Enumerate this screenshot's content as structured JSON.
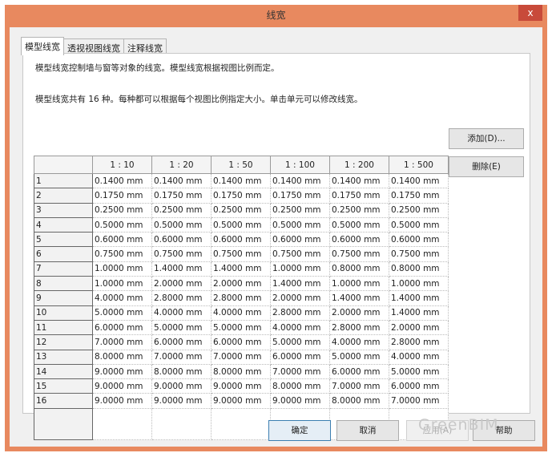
{
  "window": {
    "title": "线宽",
    "close": "x"
  },
  "tabs": [
    {
      "label": "模型线宽"
    },
    {
      "label": "透视视图线宽"
    },
    {
      "label": "注释线宽"
    }
  ],
  "description": [
    "模型线宽控制墙与窗等对象的线宽。模型线宽根据视图比例而定。",
    "模型线宽共有 16 种。每种都可以根据每个视图比例指定大小。单击单元可以修改线宽。"
  ],
  "table": {
    "columns": [
      "1 : 10",
      "1 : 20",
      "1 : 50",
      "1 : 100",
      "1 : 200",
      "1 : 500"
    ],
    "rows": [
      {
        "id": "1",
        "values": [
          "0.1400 mm",
          "0.1400 mm",
          "0.1400 mm",
          "0.1400 mm",
          "0.1400 mm",
          "0.1400 mm"
        ]
      },
      {
        "id": "2",
        "values": [
          "0.1750 mm",
          "0.1750 mm",
          "0.1750 mm",
          "0.1750 mm",
          "0.1750 mm",
          "0.1750 mm"
        ]
      },
      {
        "id": "3",
        "values": [
          "0.2500 mm",
          "0.2500 mm",
          "0.2500 mm",
          "0.2500 mm",
          "0.2500 mm",
          "0.2500 mm"
        ]
      },
      {
        "id": "4",
        "values": [
          "0.5000 mm",
          "0.5000 mm",
          "0.5000 mm",
          "0.5000 mm",
          "0.5000 mm",
          "0.5000 mm"
        ]
      },
      {
        "id": "5",
        "values": [
          "0.6000 mm",
          "0.6000 mm",
          "0.6000 mm",
          "0.6000 mm",
          "0.6000 mm",
          "0.6000 mm"
        ]
      },
      {
        "id": "6",
        "values": [
          "0.7500 mm",
          "0.7500 mm",
          "0.7500 mm",
          "0.7500 mm",
          "0.7500 mm",
          "0.7500 mm"
        ]
      },
      {
        "id": "7",
        "values": [
          "1.0000 mm",
          "1.4000 mm",
          "1.4000 mm",
          "1.0000 mm",
          "0.8000 mm",
          "0.8000 mm"
        ]
      },
      {
        "id": "8",
        "values": [
          "1.0000 mm",
          "2.0000 mm",
          "2.0000 mm",
          "1.4000 mm",
          "1.0000 mm",
          "1.0000 mm"
        ]
      },
      {
        "id": "9",
        "values": [
          "4.0000 mm",
          "2.8000 mm",
          "2.8000 mm",
          "2.0000 mm",
          "1.4000 mm",
          "1.4000 mm"
        ]
      },
      {
        "id": "10",
        "values": [
          "5.0000 mm",
          "4.0000 mm",
          "4.0000 mm",
          "2.8000 mm",
          "2.0000 mm",
          "1.4000 mm"
        ]
      },
      {
        "id": "11",
        "values": [
          "6.0000 mm",
          "5.0000 mm",
          "5.0000 mm",
          "4.0000 mm",
          "2.8000 mm",
          "2.0000 mm"
        ]
      },
      {
        "id": "12",
        "values": [
          "7.0000 mm",
          "6.0000 mm",
          "6.0000 mm",
          "5.0000 mm",
          "4.0000 mm",
          "2.8000 mm"
        ]
      },
      {
        "id": "13",
        "values": [
          "8.0000 mm",
          "7.0000 mm",
          "7.0000 mm",
          "6.0000 mm",
          "5.0000 mm",
          "4.0000 mm"
        ]
      },
      {
        "id": "14",
        "values": [
          "9.0000 mm",
          "8.0000 mm",
          "8.0000 mm",
          "7.0000 mm",
          "6.0000 mm",
          "5.0000 mm"
        ]
      },
      {
        "id": "15",
        "values": [
          "9.0000 mm",
          "9.0000 mm",
          "9.0000 mm",
          "8.0000 mm",
          "7.0000 mm",
          "6.0000 mm"
        ]
      },
      {
        "id": "16",
        "values": [
          "9.0000 mm",
          "9.0000 mm",
          "9.0000 mm",
          "9.0000 mm",
          "8.0000 mm",
          "7.0000 mm"
        ]
      }
    ]
  },
  "side_buttons": {
    "add": "添加(D)...",
    "delete": "删除(E)"
  },
  "footer": {
    "ok": "确定",
    "cancel": "取消",
    "apply": "应用(A)",
    "help": "帮助"
  },
  "watermark": "GreenBIM"
}
